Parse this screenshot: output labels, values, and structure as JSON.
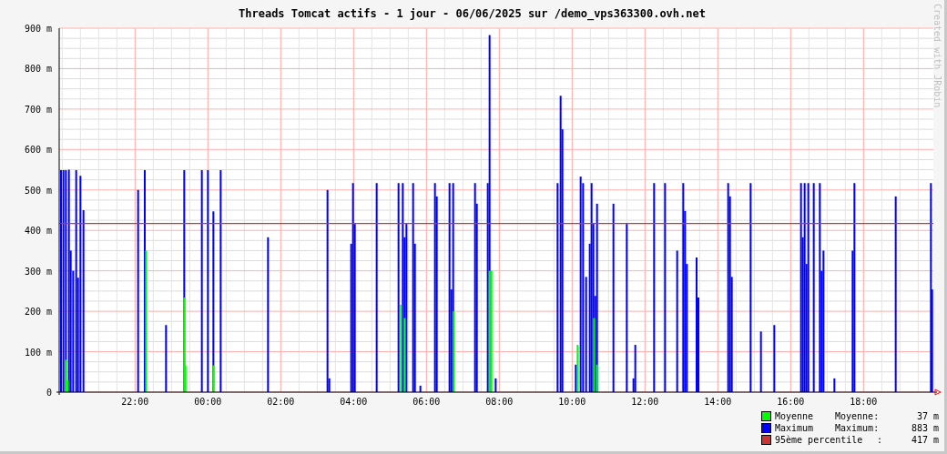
{
  "title": "Threads Tomcat actifs - 1 jour - 06/06/2025 sur /demo_vps363300.ovh.net",
  "side_text": "Created with JRobin",
  "chart": {
    "chart_data": {
      "type": "bar",
      "grid": true,
      "xlim": [
        "2025-06-05T19:55",
        "2025-06-06T19:55"
      ],
      "ylim": [
        0,
        900
      ],
      "xticks": [
        {
          "value": "2025-06-05T22:00",
          "label": "22:00"
        },
        {
          "value": "2025-06-06T00:00",
          "label": "00:00"
        },
        {
          "value": "2025-06-06T02:00",
          "label": "02:00"
        },
        {
          "value": "2025-06-06T04:00",
          "label": "04:00"
        },
        {
          "value": "2025-06-06T06:00",
          "label": "06:00"
        },
        {
          "value": "2025-06-06T08:00",
          "label": "08:00"
        },
        {
          "value": "2025-06-06T10:00",
          "label": "10:00"
        },
        {
          "value": "2025-06-06T12:00",
          "label": "12:00"
        },
        {
          "value": "2025-06-06T14:00",
          "label": "14:00"
        },
        {
          "value": "2025-06-06T16:00",
          "label": "16:00"
        },
        {
          "value": "2025-06-06T18:00",
          "label": "18:00"
        }
      ],
      "yticks": [
        {
          "value": 0,
          "label": "0"
        },
        {
          "value": 100,
          "label": "100 m"
        },
        {
          "value": 200,
          "label": "200 m"
        },
        {
          "value": 300,
          "label": "300 m"
        },
        {
          "value": 400,
          "label": "400 m"
        },
        {
          "value": 500,
          "label": "500 m"
        },
        {
          "value": 600,
          "label": "600 m"
        },
        {
          "value": 700,
          "label": "700 m"
        },
        {
          "value": 800,
          "label": "800 m"
        },
        {
          "value": 900,
          "label": "900 m"
        }
      ],
      "series": [
        {
          "name": "Moyenne",
          "color": "#00ff00",
          "x": [
            "2025-06-05T20:06",
            "2025-06-05T20:09",
            "2025-06-05T22:18",
            "2025-06-05T23:21",
            "2025-06-05T23:23",
            "2025-06-06T00:09",
            "2025-06-06T05:18",
            "2025-06-06T05:24",
            "2025-06-06T06:45",
            "2025-06-06T07:44",
            "2025-06-06T07:47",
            "2025-06-06T10:09",
            "2025-06-06T10:36",
            "2025-06-06T10:41"
          ],
          "values": [
            80,
            30,
            350,
            234,
            66,
            66,
            216,
            183,
            200,
            300,
            300,
            117,
            183,
            68
          ]
        },
        {
          "name": "Maximum",
          "color": "#0000ff",
          "x": [
            "2025-06-05T19:58",
            "2025-06-05T20:02",
            "2025-06-05T20:06",
            "2025-06-05T20:11",
            "2025-06-05T20:14",
            "2025-06-05T20:18",
            "2025-06-05T20:23",
            "2025-06-05T20:26",
            "2025-06-05T20:30",
            "2025-06-05T20:35",
            "2025-06-05T22:05",
            "2025-06-05T22:16",
            "2025-06-05T22:51",
            "2025-06-05T23:21",
            "2025-06-05T23:50",
            "2025-06-06T00:00",
            "2025-06-06T00:09",
            "2025-06-06T00:21",
            "2025-06-06T01:39",
            "2025-06-06T03:17",
            "2025-06-06T03:20",
            "2025-06-06T03:56",
            "2025-06-06T03:59",
            "2025-06-06T04:02",
            "2025-06-06T04:38",
            "2025-06-06T05:14",
            "2025-06-06T05:21",
            "2025-06-06T05:24",
            "2025-06-06T05:27",
            "2025-06-06T05:38",
            "2025-06-06T05:41",
            "2025-06-06T05:50",
            "2025-06-06T06:14",
            "2025-06-06T06:17",
            "2025-06-06T06:38",
            "2025-06-06T06:41",
            "2025-06-06T06:44",
            "2025-06-06T07:20",
            "2025-06-06T07:23",
            "2025-06-06T07:41",
            "2025-06-06T07:44",
            "2025-06-06T07:54",
            "2025-06-06T09:36",
            "2025-06-06T09:41",
            "2025-06-06T09:44",
            "2025-06-06T10:06",
            "2025-06-06T10:14",
            "2025-06-06T10:18",
            "2025-06-06T10:23",
            "2025-06-06T10:29",
            "2025-06-06T10:32",
            "2025-06-06T10:35",
            "2025-06-06T10:38",
            "2025-06-06T10:41",
            "2025-06-06T11:08",
            "2025-06-06T11:30",
            "2025-06-06T11:41",
            "2025-06-06T11:44",
            "2025-06-06T12:15",
            "2025-06-06T12:33",
            "2025-06-06T12:53",
            "2025-06-06T13:03",
            "2025-06-06T13:06",
            "2025-06-06T13:09",
            "2025-06-06T13:25",
            "2025-06-06T13:28",
            "2025-06-06T14:17",
            "2025-06-06T14:20",
            "2025-06-06T14:23",
            "2025-06-06T14:54",
            "2025-06-06T15:11",
            "2025-06-06T15:33",
            "2025-06-06T16:17",
            "2025-06-06T16:20",
            "2025-06-06T16:23",
            "2025-06-06T16:26",
            "2025-06-06T16:29",
            "2025-06-06T16:38",
            "2025-06-06T16:48",
            "2025-06-06T16:51",
            "2025-06-06T16:54",
            "2025-06-06T17:12",
            "2025-06-06T17:42",
            "2025-06-06T17:45",
            "2025-06-06T18:53",
            "2025-06-06T19:51",
            "2025-06-06T19:53"
          ],
          "values": [
            549,
            549,
            549,
            550,
            350,
            300,
            549,
            283,
            535,
            450,
            500,
            549,
            166,
            549,
            549,
            549,
            447,
            549,
            383,
            500,
            34,
            367,
            517,
            416,
            517,
            517,
            517,
            383,
            416,
            517,
            367,
            16,
            517,
            484,
            517,
            254,
            517,
            517,
            466,
            517,
            883,
            34,
            517,
            733,
            650,
            68,
            533,
            517,
            285,
            367,
            517,
            416,
            238,
            466,
            466,
            416,
            34,
            117,
            517,
            517,
            350,
            517,
            448,
            317,
            333,
            234,
            517,
            484,
            285,
            517,
            150,
            166,
            517,
            383,
            517,
            317,
            517,
            517,
            517,
            300,
            350,
            34,
            350,
            517,
            484,
            517,
            254
          ]
        }
      ],
      "ref_lines": [
        {
          "axis": "y",
          "value": 417,
          "label": "95ème percentile",
          "color": "#cc3333"
        }
      ]
    }
  },
  "legend": [
    {
      "label": "Moyenne:",
      "value": "37 m"
    },
    {
      "label": "Maximum:",
      "value": "883 m"
    },
    {
      "label": ":",
      "value": "417 m"
    }
  ]
}
